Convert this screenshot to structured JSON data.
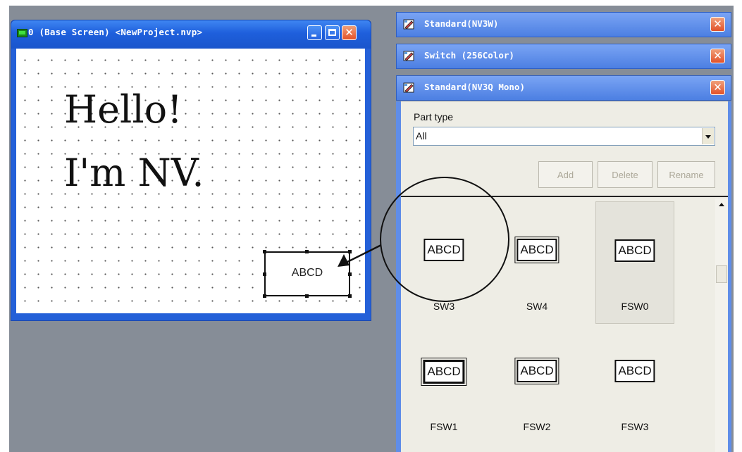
{
  "base_window": {
    "title": "0 (Base Screen) <NewProject.nvp>",
    "canvas_text": [
      "Hello!",
      "I'm NV."
    ],
    "part_label": "ABCD",
    "icons": {
      "app": "screen-icon",
      "minimize": "minimize-icon",
      "maximize": "maximize-icon",
      "close": "close-icon"
    }
  },
  "panels": [
    {
      "title": "Standard(NV3W)",
      "icon": "parts-library-icon"
    },
    {
      "title": "Switch (256Color)",
      "icon": "parts-library-icon"
    },
    {
      "title": "Standard(NV3Q Mono)",
      "icon": "parts-library-icon"
    }
  ],
  "parts_panel": {
    "part_type_label": "Part type",
    "part_type_value": "All",
    "buttons": {
      "add": "Add",
      "delete": "Delete",
      "rename": "Rename"
    },
    "items": [
      {
        "name": "SW3",
        "icon_text": "ABCD"
      },
      {
        "name": "SW4",
        "icon_text": "ABCD"
      },
      {
        "name": "FSW0",
        "icon_text": "ABCD"
      },
      {
        "name": "FSW1",
        "icon_text": "ABCD"
      },
      {
        "name": "FSW2",
        "icon_text": "ABCD"
      },
      {
        "name": "FSW3",
        "icon_text": "ABCD"
      }
    ]
  },
  "colors": {
    "desktop": "#868d97",
    "titlebar": "#2460d8",
    "panel_titlebar": "#6a97ef",
    "close_button": "#e2522a",
    "panel_body": "#eeede5"
  },
  "annotations": {
    "highlight": "circle-callout",
    "pointer": "arrow"
  }
}
